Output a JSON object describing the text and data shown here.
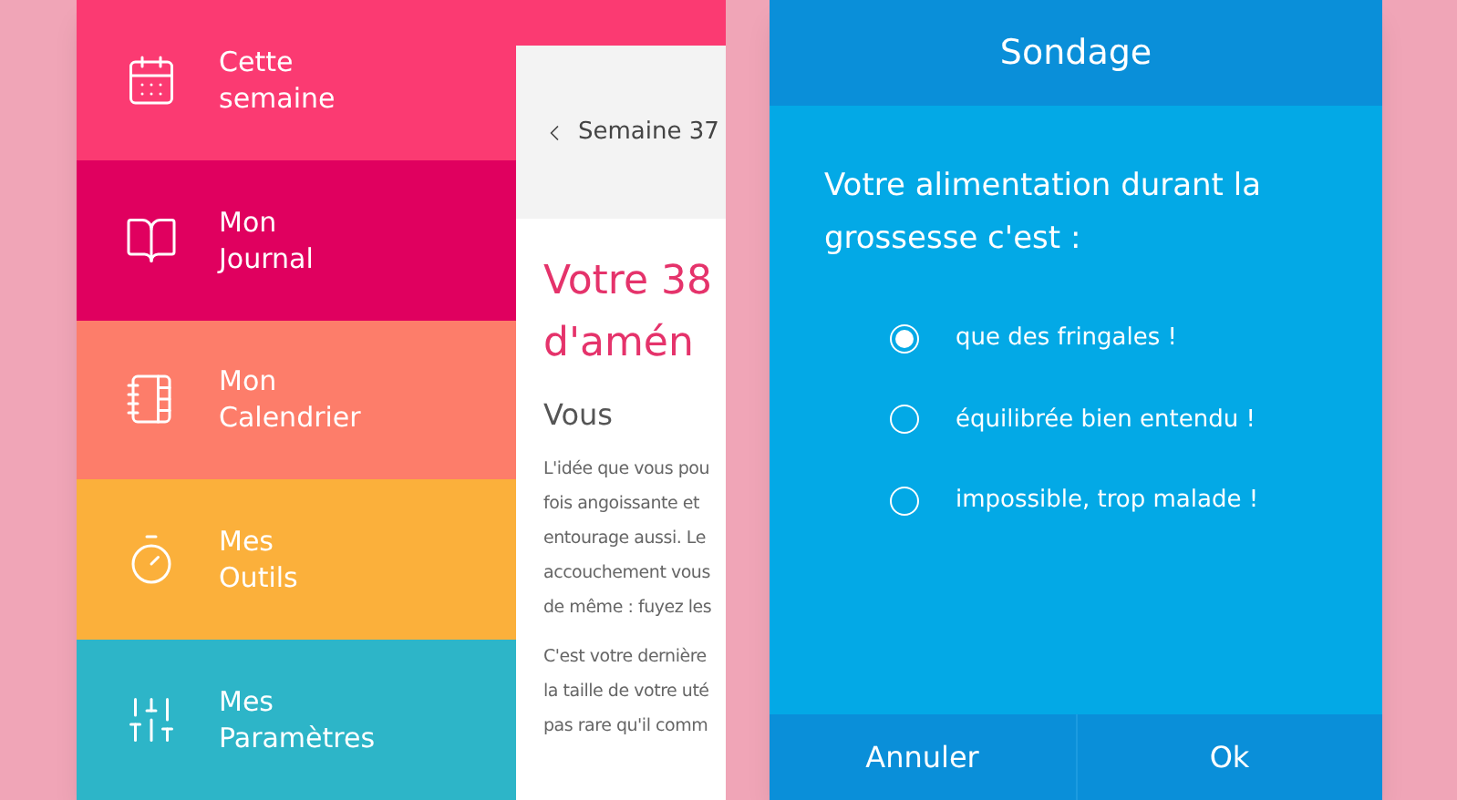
{
  "menu": {
    "items": [
      {
        "label": "Cette semaine",
        "color": "#fb3a72"
      },
      {
        "label": "Mon Journal",
        "color": "#e0005f"
      },
      {
        "label": "Mon Calendrier",
        "color": "#fd7d6a"
      },
      {
        "label": "Mes Outils",
        "color": "#fbb03b"
      },
      {
        "label": "Mes Paramètres",
        "color": "#2db5c8"
      }
    ]
  },
  "article": {
    "back_label": "Semaine 37",
    "title_lines": [
      "Votre 38",
      "d'amén"
    ],
    "heading": "Vous",
    "paragraphs": [
      [
        "L'idée que vous pou",
        "fois angoissante et",
        "entourage aussi. Le",
        "accouchement vous",
        "de même : fuyez les"
      ],
      [
        "C'est votre dernière",
        "la taille de votre uté",
        "pas rare qu'il comm"
      ]
    ]
  },
  "survey": {
    "title": "Sondage",
    "question": "Votre alimentation durant la grossesse c'est :",
    "options": [
      {
        "label": "que des fringales !",
        "selected": true
      },
      {
        "label": "équilibrée bien entendu !",
        "selected": false
      },
      {
        "label": "impossible, trop malade !",
        "selected": false
      }
    ],
    "buttons": [
      "Annuler",
      "Ok"
    ]
  }
}
